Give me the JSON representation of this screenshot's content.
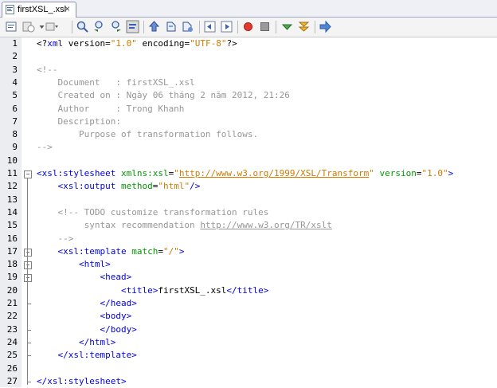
{
  "tab": {
    "name": "firstXSL_.xsl",
    "close": "×"
  },
  "toolbar": {
    "buttons": [
      "source-icon",
      "history-icon",
      "back-dropdown-icon",
      "forward-dropdown-icon",
      "find-icon",
      "find-prev-icon",
      "find-next-icon",
      "toggle-highlight-icon",
      "prev-bookmark-icon",
      "next-bookmark-icon",
      "toggle-bookmark-icon",
      "shift-left-icon",
      "shift-right-icon",
      "record-macro-icon",
      "stop-macro-icon",
      "check-xml-icon",
      "validate-xml-icon",
      "xsl-transform-icon"
    ]
  },
  "lines": [
    {
      "n": "1",
      "parts": [
        [
          "pi",
          "<?"
        ],
        [
          "tag",
          "xml"
        ],
        [
          "pi",
          " version="
        ],
        [
          "val",
          "\"1.0\""
        ],
        [
          "pi",
          " encoding="
        ],
        [
          "val",
          "\"UTF-8\""
        ],
        [
          "pi",
          "?>"
        ]
      ]
    },
    {
      "n": "2",
      "parts": []
    },
    {
      "n": "3",
      "parts": [
        [
          "c",
          "<!--"
        ]
      ]
    },
    {
      "n": "4",
      "parts": [
        [
          "c",
          "    Document   : firstXSL_.xsl"
        ]
      ]
    },
    {
      "n": "5",
      "parts": [
        [
          "c",
          "    Created on : Ngày 06 tháng 2 năm 2012, 21:26"
        ]
      ]
    },
    {
      "n": "6",
      "parts": [
        [
          "c",
          "    Author     : Trong Khanh"
        ]
      ]
    },
    {
      "n": "7",
      "parts": [
        [
          "c",
          "    Description:"
        ]
      ]
    },
    {
      "n": "8",
      "parts": [
        [
          "c",
          "        Purpose of transformation follows."
        ]
      ]
    },
    {
      "n": "9",
      "parts": [
        [
          "c",
          "-->"
        ]
      ]
    },
    {
      "n": "10",
      "parts": []
    },
    {
      "n": "11",
      "parts": [
        [
          "tag",
          "<xsl:stylesheet"
        ],
        [
          "attr",
          " xmlns:xsl"
        ],
        [
          "txt",
          "="
        ],
        [
          "val",
          "\""
        ],
        [
          "url",
          "http://www.w3.org/1999/XSL/Transform"
        ],
        [
          "val",
          "\""
        ],
        [
          "attr",
          " version"
        ],
        [
          "txt",
          "="
        ],
        [
          "val",
          "\"1.0\""
        ],
        [
          "tag",
          ">"
        ]
      ]
    },
    {
      "n": "12",
      "parts": [
        [
          "txt",
          "    "
        ],
        [
          "tag",
          "<xsl:output"
        ],
        [
          "attr",
          " method"
        ],
        [
          "txt",
          "="
        ],
        [
          "val",
          "\"html\""
        ],
        [
          "tag",
          "/>"
        ]
      ]
    },
    {
      "n": "13",
      "parts": []
    },
    {
      "n": "14",
      "parts": [
        [
          "c",
          "    <!-- TODO customize transformation rules"
        ]
      ]
    },
    {
      "n": "15",
      "parts": [
        [
          "c",
          "         syntax recommendation "
        ],
        [
          "urlc",
          "http://www.w3.org/TR/xslt"
        ]
      ]
    },
    {
      "n": "16",
      "parts": [
        [
          "c",
          "    -->"
        ]
      ]
    },
    {
      "n": "17",
      "parts": [
        [
          "txt",
          "    "
        ],
        [
          "tag",
          "<xsl:template"
        ],
        [
          "attr",
          " match"
        ],
        [
          "txt",
          "="
        ],
        [
          "val",
          "\"/\""
        ],
        [
          "tag",
          ">"
        ]
      ]
    },
    {
      "n": "18",
      "parts": [
        [
          "txt",
          "        "
        ],
        [
          "tag",
          "<html>"
        ]
      ]
    },
    {
      "n": "19",
      "parts": [
        [
          "txt",
          "            "
        ],
        [
          "tag",
          "<head>"
        ]
      ]
    },
    {
      "n": "20",
      "parts": [
        [
          "txt",
          "                "
        ],
        [
          "tag",
          "<title>"
        ],
        [
          "txt",
          "firstXSL_.xsl"
        ],
        [
          "tag",
          "</title>"
        ]
      ]
    },
    {
      "n": "21",
      "parts": [
        [
          "txt",
          "            "
        ],
        [
          "tag",
          "</head>"
        ]
      ]
    },
    {
      "n": "22",
      "parts": [
        [
          "txt",
          "            "
        ],
        [
          "tag",
          "<body>"
        ]
      ]
    },
    {
      "n": "23",
      "parts": [
        [
          "txt",
          "            "
        ],
        [
          "tag",
          "</body>"
        ]
      ]
    },
    {
      "n": "24",
      "parts": [
        [
          "txt",
          "        "
        ],
        [
          "tag",
          "</html>"
        ]
      ]
    },
    {
      "n": "25",
      "parts": [
        [
          "txt",
          "    "
        ],
        [
          "tag",
          "</xsl:template>"
        ]
      ]
    },
    {
      "n": "26",
      "parts": []
    },
    {
      "n": "27",
      "parts": [
        [
          "tag",
          "</xsl:stylesheet>"
        ]
      ]
    }
  ]
}
